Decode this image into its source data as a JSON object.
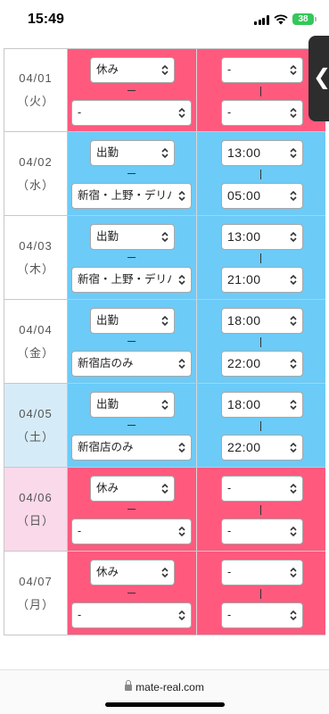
{
  "status_bar": {
    "time": "15:49",
    "battery": "38"
  },
  "colors": {
    "off": "#ff5a7e",
    "on": "#6ccbf7",
    "saturday": "#d6ebf8",
    "sunday": "#fad9ea"
  },
  "rows": [
    {
      "date": "04/01",
      "weekday": "（火）",
      "status": "休み",
      "shop": "-",
      "start": "-",
      "end": "-"
    },
    {
      "date": "04/02",
      "weekday": "（水）",
      "status": "出勤",
      "shop": "新宿・上野・デリバ",
      "start": "13:00",
      "end": "05:00"
    },
    {
      "date": "04/03",
      "weekday": "（木）",
      "status": "出勤",
      "shop": "新宿・上野・デリバ",
      "start": "13:00",
      "end": "21:00"
    },
    {
      "date": "04/04",
      "weekday": "（金）",
      "status": "出勤",
      "shop": "新宿店のみ",
      "start": "18:00",
      "end": "22:00"
    },
    {
      "date": "04/05",
      "weekday": "（土）",
      "status": "出勤",
      "shop": "新宿店のみ",
      "start": "18:00",
      "end": "22:00"
    },
    {
      "date": "04/06",
      "weekday": "（日）",
      "status": "休み",
      "shop": "-",
      "start": "-",
      "end": "-"
    },
    {
      "date": "04/07",
      "weekday": "（月）",
      "status": "休み",
      "shop": "-",
      "start": "-",
      "end": "-"
    }
  ],
  "side_tab": {
    "glyph": "❮"
  },
  "browser": {
    "url": "mate-real.com"
  }
}
